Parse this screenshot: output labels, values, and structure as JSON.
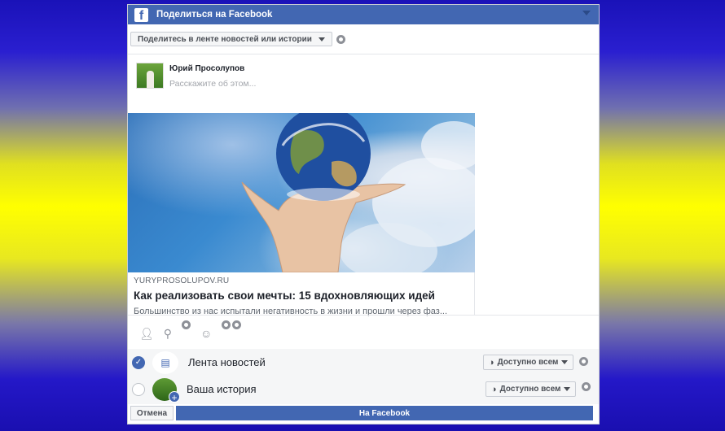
{
  "dialog": {
    "title": "Поделиться на Facebook",
    "logo_letter": "f"
  },
  "destination": {
    "selected": "Поделитесь в ленте новостей или истории"
  },
  "composer": {
    "user_name": "Юрий Просолупов",
    "placeholder": "Расскажите об этом..."
  },
  "link_preview": {
    "domain": "YURYPROSOLUPOV.RU",
    "title": "Как реализовать свои мечты: 15 вдохновляющих идей",
    "description": "Большинство из нас испытали негативность в жизни и прошли через фаз..."
  },
  "actions": {
    "icons": [
      "tag-people-icon",
      "location-icon",
      "feeling-icon"
    ]
  },
  "post_targets": [
    {
      "label": "Лента новостей",
      "checked": true,
      "audience": "Доступно всем"
    },
    {
      "label": "Ваша история",
      "checked": false,
      "audience": "Доступно всем"
    }
  ],
  "footer": {
    "cancel_label": "Отмена",
    "share_label": "На Facebook"
  },
  "colors": {
    "brand": "#4267b2",
    "background_top": "#1a12b8",
    "background_middle": "#ffff00"
  }
}
